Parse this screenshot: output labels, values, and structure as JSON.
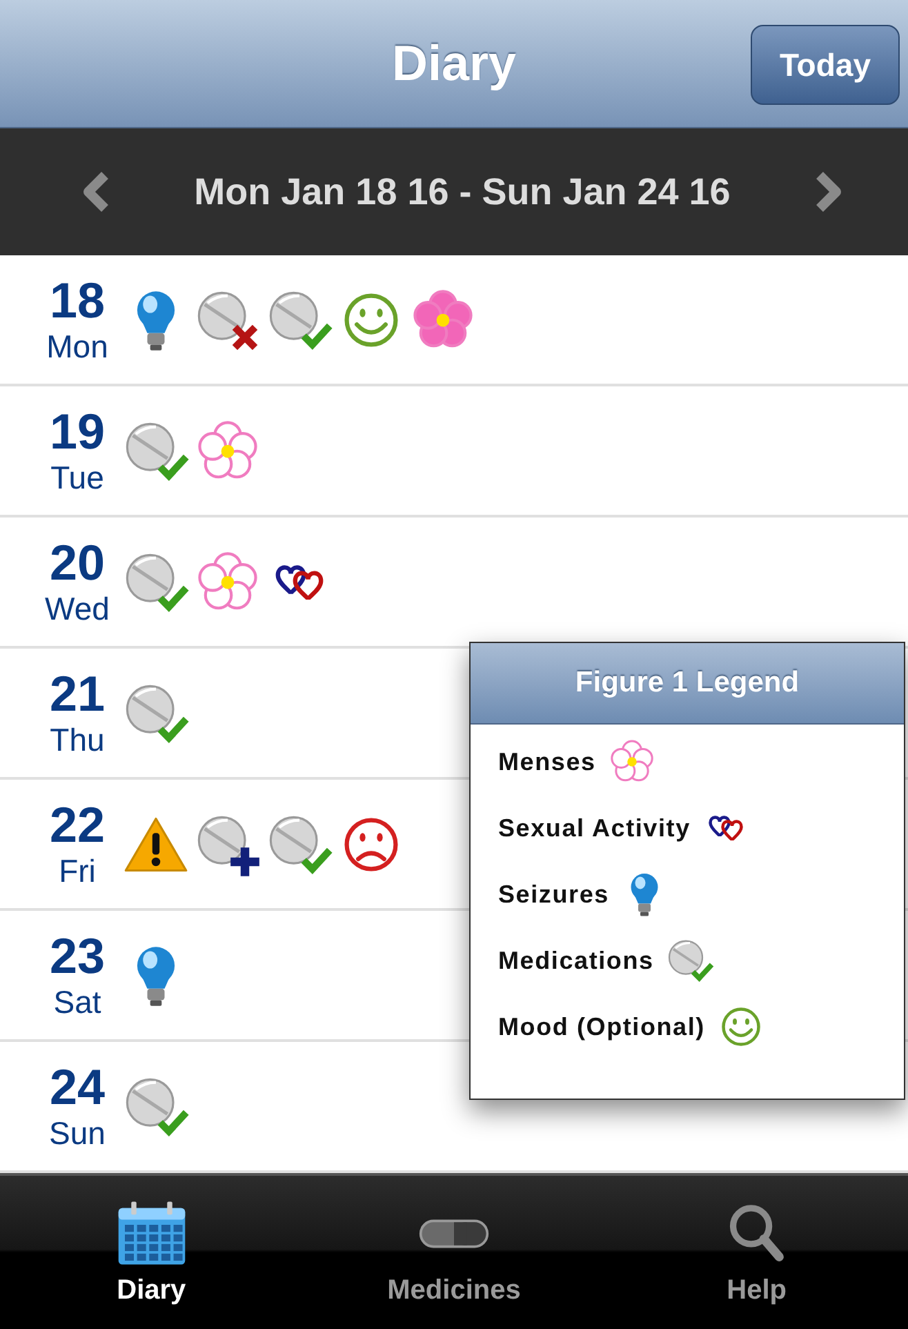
{
  "header": {
    "title": "Diary",
    "today_button": "Today"
  },
  "date_range": {
    "label": "Mon Jan 18 16 - Sun Jan 24 16"
  },
  "days": [
    {
      "day": "18",
      "weekday": "Mon",
      "icons": [
        {
          "kind": "bulb"
        },
        {
          "kind": "pill-cross"
        },
        {
          "kind": "pill-check"
        },
        {
          "kind": "smile"
        },
        {
          "kind": "flower-filled"
        }
      ]
    },
    {
      "day": "19",
      "weekday": "Tue",
      "icons": [
        {
          "kind": "pill-check"
        },
        {
          "kind": "flower"
        }
      ]
    },
    {
      "day": "20",
      "weekday": "Wed",
      "icons": [
        {
          "kind": "pill-check"
        },
        {
          "kind": "flower"
        },
        {
          "kind": "hearts"
        }
      ]
    },
    {
      "day": "21",
      "weekday": "Thu",
      "icons": [
        {
          "kind": "pill-check"
        }
      ]
    },
    {
      "day": "22",
      "weekday": "Fri",
      "icons": [
        {
          "kind": "warning"
        },
        {
          "kind": "pill-plus"
        },
        {
          "kind": "pill-check"
        },
        {
          "kind": "frown"
        }
      ]
    },
    {
      "day": "23",
      "weekday": "Sat",
      "icons": [
        {
          "kind": "bulb"
        }
      ]
    },
    {
      "day": "24",
      "weekday": "Sun",
      "icons": [
        {
          "kind": "pill-check"
        }
      ]
    }
  ],
  "legend": {
    "title": "Figure 1 Legend",
    "items": [
      {
        "label": "Menses",
        "kind": "flower"
      },
      {
        "label": "Sexual Activity",
        "kind": "hearts"
      },
      {
        "label": "Seizures",
        "kind": "bulb"
      },
      {
        "label": "Medications",
        "kind": "pill-check"
      },
      {
        "label": "Mood (Optional)",
        "kind": "smile"
      }
    ]
  },
  "tabs": [
    {
      "label": "Diary",
      "kind": "calendar",
      "selected": true
    },
    {
      "label": "Medicines",
      "kind": "capsule",
      "selected": false
    },
    {
      "label": "Help",
      "kind": "search",
      "selected": false
    }
  ]
}
